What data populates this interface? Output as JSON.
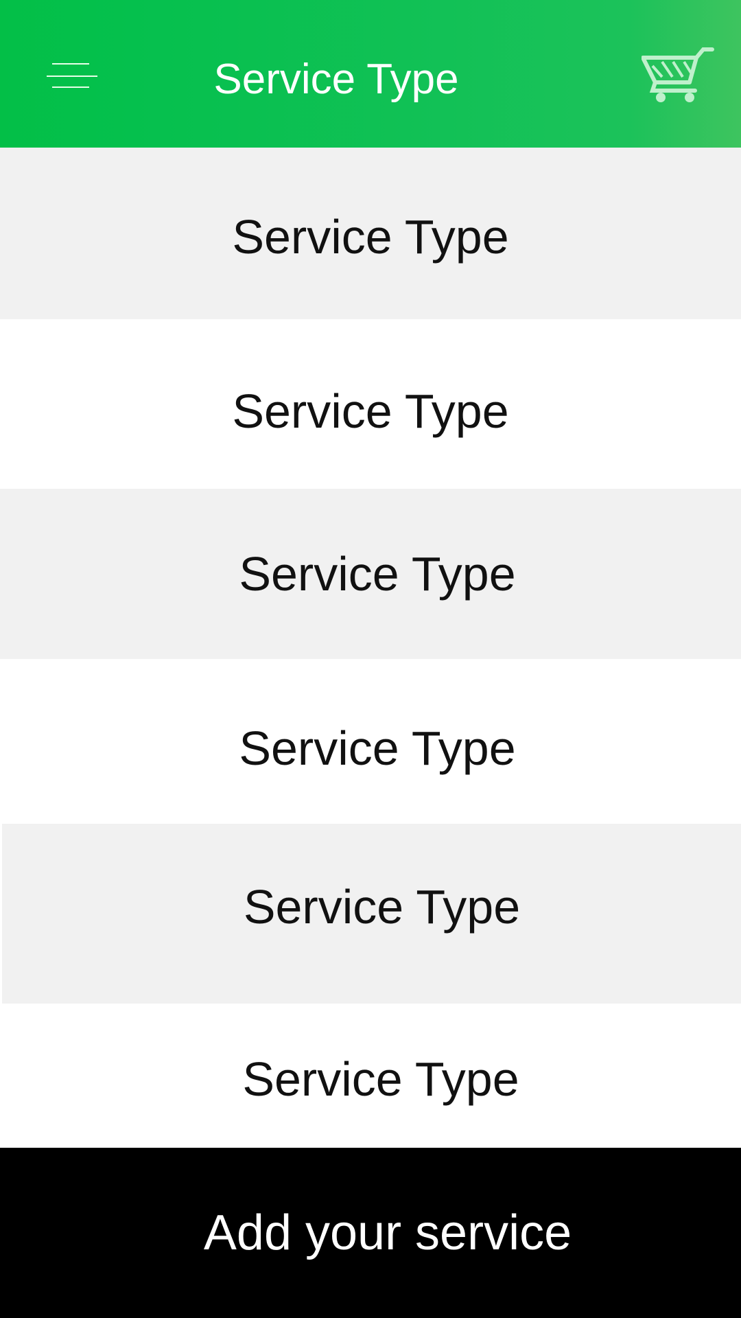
{
  "header": {
    "title": "Service Type",
    "menu_icon": "hamburger-menu-icon",
    "cart_icon": "shopping-cart-icon",
    "background_color": "#0bc04f"
  },
  "service_list": {
    "items": [
      {
        "label": "Service Type"
      },
      {
        "label": "Service Type"
      },
      {
        "label": "Service Type"
      },
      {
        "label": "Service Type"
      },
      {
        "label": "Service Type"
      },
      {
        "label": "Service Type"
      }
    ],
    "shade_color": "#f1f1f1"
  },
  "footer": {
    "button_label": "Add your service",
    "background_color": "#000000"
  }
}
